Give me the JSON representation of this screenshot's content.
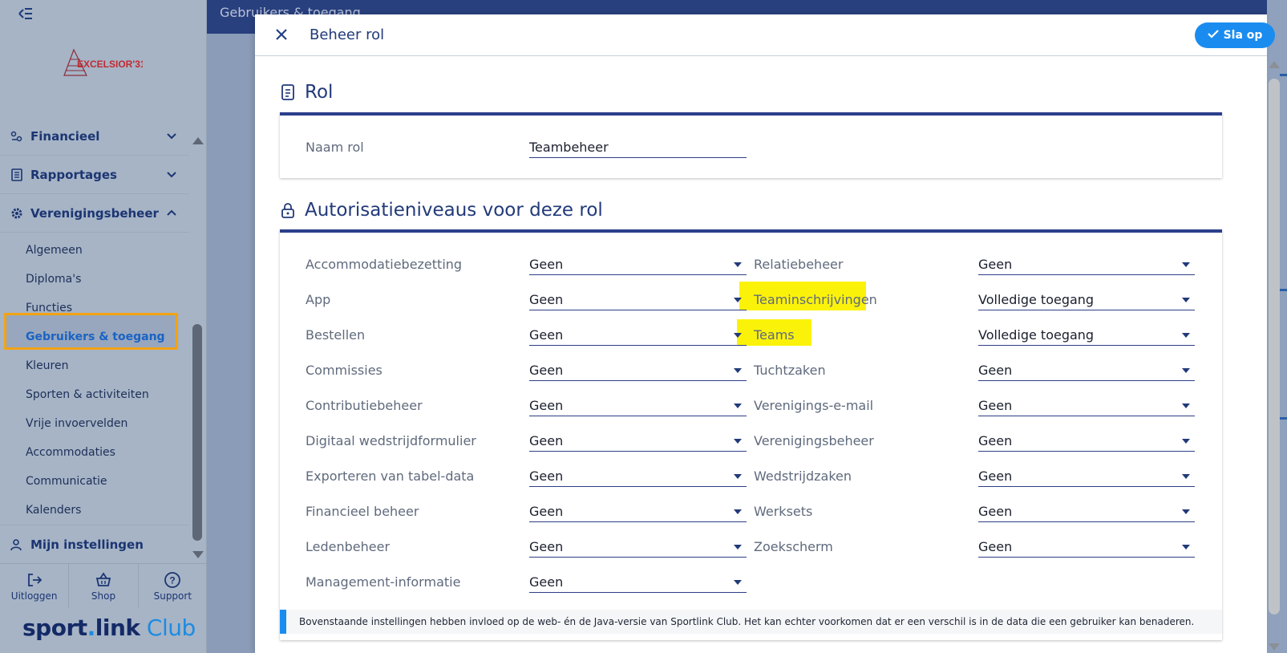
{
  "sidebar": {
    "logo_text": "EXCELSIOR'31",
    "groups": [
      {
        "label": "Financieel"
      },
      {
        "label": "Rapportages"
      },
      {
        "label": "Verenigingsbeheer"
      },
      {
        "label": "Mijn instellingen"
      }
    ],
    "sub_items": [
      {
        "label": "Algemeen"
      },
      {
        "label": "Diploma's"
      },
      {
        "label": "Functies"
      },
      {
        "label": "Gebruikers & toegang"
      },
      {
        "label": "Kleuren"
      },
      {
        "label": "Sporten & activiteiten"
      },
      {
        "label": "Vrije invoervelden"
      },
      {
        "label": "Accommodaties"
      },
      {
        "label": "Communicatie"
      },
      {
        "label": "Kalenders"
      }
    ],
    "bottom": {
      "logout": "Uitloggen",
      "shop": "Shop",
      "support": "Support"
    },
    "brand": {
      "sport": "sport",
      "dot": ".",
      "link": "link",
      "club": " Club"
    }
  },
  "background_header": {
    "title": "Gebruikers & toegang"
  },
  "modal": {
    "title": "Beheer rol",
    "save_label": "Sla op",
    "rol_section": {
      "title": "Rol",
      "name_label": "Naam rol",
      "name_value": "Teambeheer"
    },
    "auth_section": {
      "title": "Autorisatieniveaus voor deze rol",
      "left": [
        {
          "label": "Accommodatiebezetting",
          "value": "Geen"
        },
        {
          "label": "App",
          "value": "Geen"
        },
        {
          "label": "Bestellen",
          "value": "Geen"
        },
        {
          "label": "Commissies",
          "value": "Geen"
        },
        {
          "label": "Contributiebeheer",
          "value": "Geen"
        },
        {
          "label": "Digitaal wedstrijdformulier",
          "value": "Geen"
        },
        {
          "label": "Exporteren van tabel-data",
          "value": "Geen"
        },
        {
          "label": "Financieel beheer",
          "value": "Geen"
        },
        {
          "label": "Ledenbeheer",
          "value": "Geen"
        },
        {
          "label": "Management-informatie",
          "value": "Geen"
        }
      ],
      "right": [
        {
          "label": "Relatiebeheer",
          "value": "Geen"
        },
        {
          "label": "Teaminschrijvingen",
          "value": "Volledige toegang"
        },
        {
          "label": "Teams",
          "value": "Volledige toegang"
        },
        {
          "label": "Tuchtzaken",
          "value": "Geen"
        },
        {
          "label": "Verenigings-e-mail",
          "value": "Geen"
        },
        {
          "label": "Verenigingsbeheer",
          "value": "Geen"
        },
        {
          "label": "Wedstrijdzaken",
          "value": "Geen"
        },
        {
          "label": "Werksets",
          "value": "Geen"
        },
        {
          "label": "Zoekscherm",
          "value": "Geen"
        }
      ]
    },
    "info_text": "Bovenstaande instellingen hebben invloed op de web- én de Java-versie van Sportlink Club. Het kan echter voorkomen dat er een verschil is in de data die een gebruiker kan benaderen."
  },
  "colors": {
    "accent": "#1a8cf0",
    "navy": "#223a7a",
    "highlight": "#fbf20a",
    "active_outline": "#f2a313"
  }
}
